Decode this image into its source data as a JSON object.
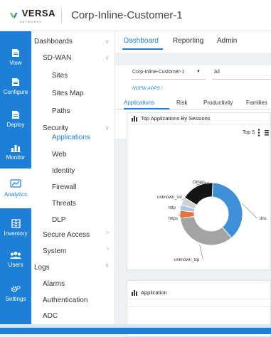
{
  "header": {
    "logo_text": "VERSA",
    "logo_sub": "NETWORKS",
    "title": "Corp-Inline-Customer-1"
  },
  "rail": [
    {
      "label": "View",
      "icon": "view-icon"
    },
    {
      "label": "Configure",
      "icon": "configure-icon"
    },
    {
      "label": "Deploy",
      "icon": "deploy-icon"
    },
    {
      "label": "Monitor",
      "icon": "monitor-icon"
    },
    {
      "label": "Analytics",
      "icon": "analytics-icon",
      "active": true
    },
    {
      "label": "Inventory",
      "icon": "inventory-icon"
    },
    {
      "label": "Users",
      "icon": "users-icon"
    },
    {
      "label": "Settings",
      "icon": "settings-icon"
    }
  ],
  "menu": [
    {
      "label": "Dashboards",
      "chevron": "down"
    },
    {
      "label": "SD-WAN",
      "chevron": "down"
    },
    {
      "label": "Sites"
    },
    {
      "label": "Sites Map"
    },
    {
      "label": "Paths"
    },
    {
      "label": "Security",
      "chevron": "down"
    },
    {
      "label": "Applications",
      "selected": true
    },
    {
      "label": "Web"
    },
    {
      "label": "Identity"
    },
    {
      "label": "Firewall"
    },
    {
      "label": "Threats"
    },
    {
      "label": "DLP"
    },
    {
      "label": "Secure Access",
      "chevron": "right"
    },
    {
      "label": "System",
      "chevron": "right"
    },
    {
      "label": "Logs",
      "chevron": "down"
    },
    {
      "label": "Alarms"
    },
    {
      "label": "Authentication"
    },
    {
      "label": "ADC"
    }
  ],
  "top_tabs": [
    "Dashboard",
    "Reporting",
    "Admin"
  ],
  "filters": {
    "tenant": "Corp-Inline-Customer-1",
    "scope": "All"
  },
  "breadcrumb": "NGFW.APPS /",
  "sub_tabs": [
    "Applications",
    "Risk",
    "Productivity",
    "Families"
  ],
  "card1": {
    "title": "Top Applications By Sessions",
    "top_selector": "Top 5"
  },
  "card2": {
    "title": "Application"
  },
  "chart_data": {
    "type": "pie",
    "categories": [
      "dns",
      "unknown_tcp",
      "https",
      "http",
      "unknown_ssl",
      "Others"
    ],
    "values": [
      38,
      34,
      4,
      3,
      4,
      17
    ],
    "colors": [
      "#3f8fd9",
      "#a3a3a3",
      "#e8703a",
      "#a7c5e6",
      "#d0d0d0",
      "#141414"
    ]
  },
  "colors": {
    "accent": "#1e7fd6",
    "rail": "#1e7fd6"
  }
}
